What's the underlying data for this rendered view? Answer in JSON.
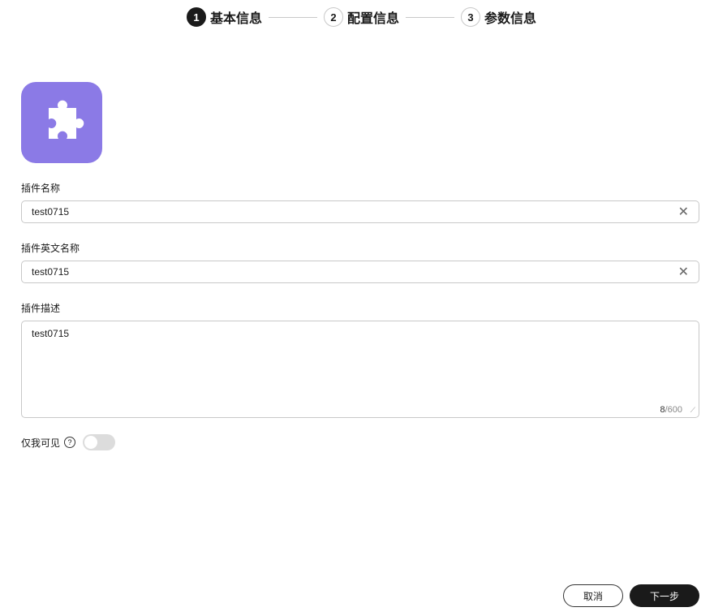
{
  "steps": [
    {
      "num": "1",
      "label": "基本信息"
    },
    {
      "num": "2",
      "label": "配置信息"
    },
    {
      "num": "3",
      "label": "参数信息"
    }
  ],
  "form": {
    "name_label": "插件名称",
    "name_value": "test0715",
    "en_name_label": "插件英文名称",
    "en_name_value": "test0715",
    "desc_label": "插件描述",
    "desc_value": "test0715",
    "desc_count": "8",
    "desc_max": "/600",
    "visible_label": "仅我可见",
    "visible_on": false
  },
  "buttons": {
    "cancel": "取消",
    "next": "下一步"
  },
  "colors": {
    "logo_bg": "#8b7ae6",
    "primary": "#1a1a1a"
  }
}
